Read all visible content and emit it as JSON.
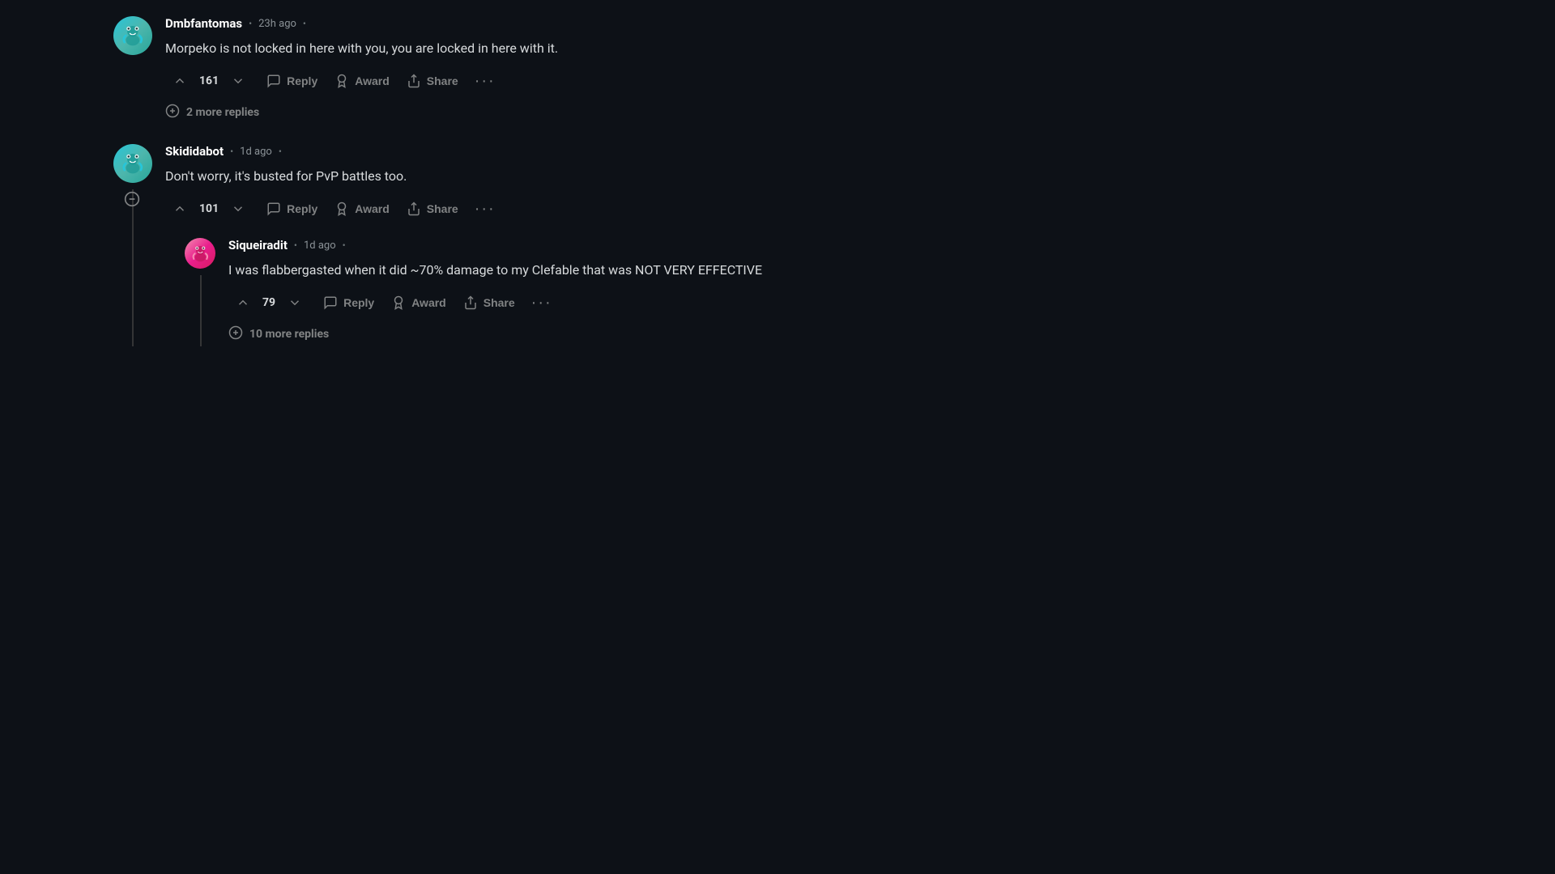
{
  "comments": [
    {
      "id": "comment-1",
      "username": "Dmbfantomas",
      "timestamp": "23h ago",
      "text": "Morpeko is not locked in here with you, you are locked in here with it.",
      "upvotes": "161",
      "more_replies_text": "2 more replies"
    },
    {
      "id": "comment-2",
      "username": "Skididabot",
      "timestamp": "1d ago",
      "text": "Don't worry, it's busted for PvP battles too.",
      "upvotes": "101",
      "nested": {
        "username": "Siqueiradit",
        "timestamp": "1d ago",
        "text": "I was flabbergasted when it did ~70% damage to my Clefable that was NOT VERY EFFECTIVE",
        "upvotes": "79",
        "more_replies_text": "10 more replies"
      }
    }
  ],
  "actions": {
    "reply": "Reply",
    "award": "Award",
    "share": "Share"
  }
}
